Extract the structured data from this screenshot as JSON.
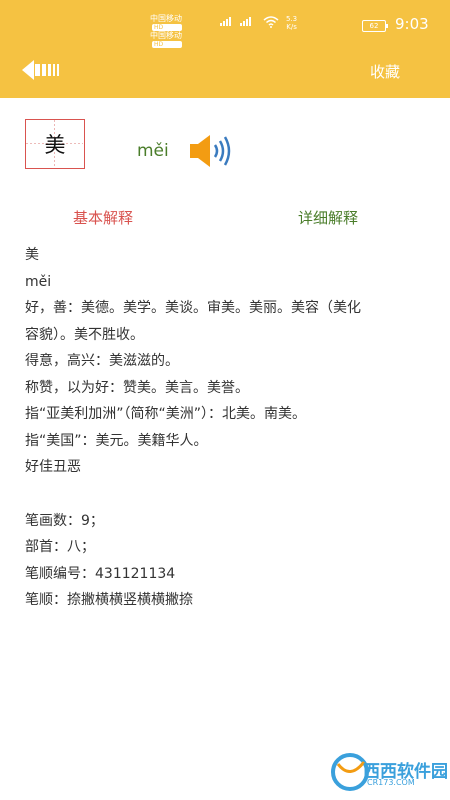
{
  "status_bar": {
    "carrier1": "中国移动",
    "carrier2": "中国移动",
    "hd": "HD",
    "net_speed_value": "5.3",
    "net_speed_unit": "K/s",
    "battery": "62",
    "time": "9:03"
  },
  "header": {
    "favorite_label": "收藏"
  },
  "character": {
    "char": "美",
    "pinyin": "měi"
  },
  "tabs": {
    "basic": "基本解释",
    "detail": "详细解释"
  },
  "definition": {
    "lines": [
      "美",
      "měi",
      "好，善：美德。美学。美谈。审美。美丽。美容（美化",
      "容貌）。美不胜收。",
      "得意，高兴：美滋滋的。",
      "称赞，以为好：赞美。美言。美誉。",
      "指“亚美利加洲”（简称“美洲”）：北美。南美。",
      "指“美国”：美元。美籍华人。",
      "好佳丑恶"
    ],
    "stats": [
      "笔画数：9；",
      "部首：八；",
      "笔顺编号：431121134",
      "笔顺：捺撇横横竖横横撇捺"
    ]
  },
  "watermark": {
    "name": "西西软件园",
    "url": "CR173.COM"
  },
  "colors": {
    "header_bg": "#f5c242",
    "tab_basic": "#d9534f",
    "tab_detail": "#4a7d2a",
    "speaker": "#f39c12"
  }
}
